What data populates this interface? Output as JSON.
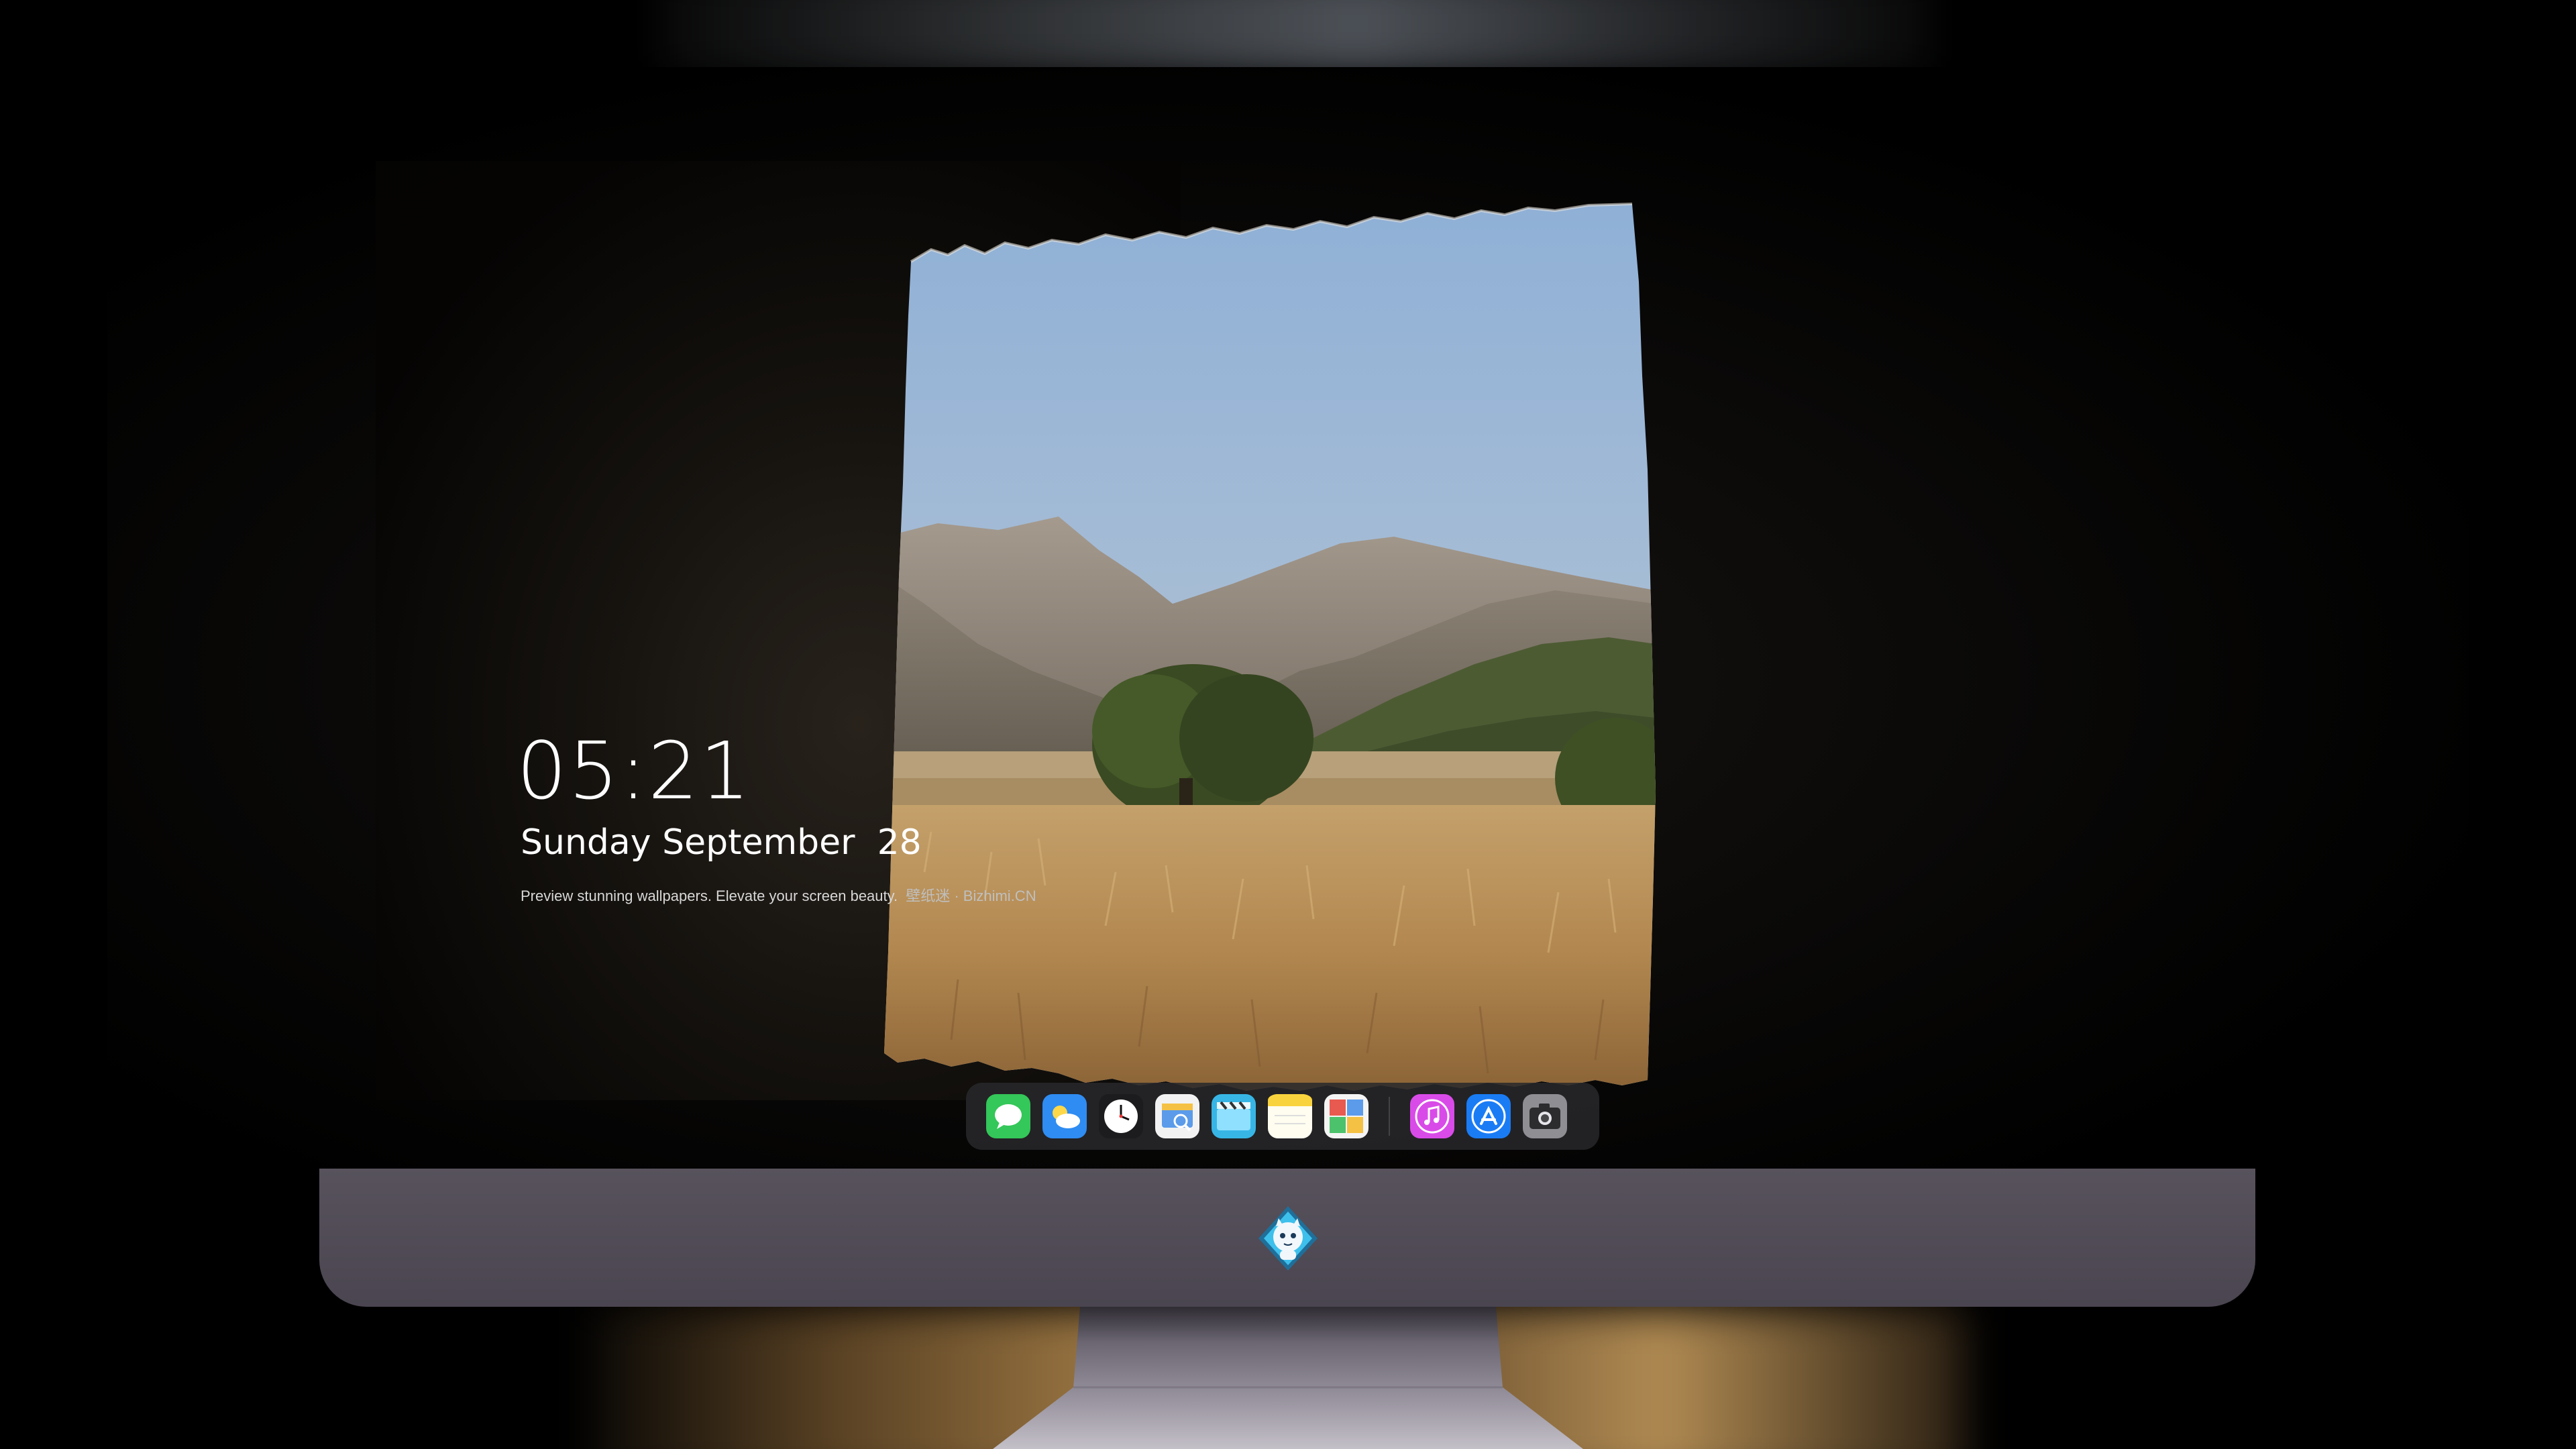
{
  "lockscreen": {
    "time": "05:21",
    "date": "Sunday September  28",
    "caption_text": "Preview stunning wallpapers. Elevate your screen beauty.",
    "caption_brand": "壁纸迷 · Bizhimi.CN"
  },
  "dock": {
    "apps": [
      {
        "name": "messages-icon"
      },
      {
        "name": "weather-icon"
      },
      {
        "name": "clock-icon"
      },
      {
        "name": "preview-icon"
      },
      {
        "name": "clips-icon"
      },
      {
        "name": "notes-icon"
      },
      {
        "name": "photo-booth-icon"
      },
      {
        "name": "music-icon"
      },
      {
        "name": "app-store-icon"
      },
      {
        "name": "camera-icon"
      }
    ]
  },
  "monitor": {
    "logo": "mascot-logo-icon"
  },
  "colors": {
    "chin": "#4e4953",
    "dock_bg": "#28282c",
    "sky": "#a9bdd4",
    "grass": "#b8925a"
  }
}
